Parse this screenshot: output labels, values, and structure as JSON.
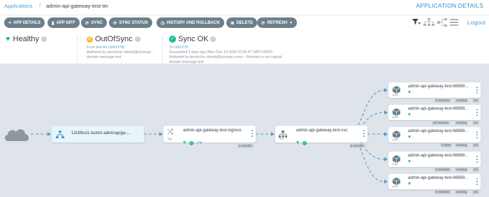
{
  "breadcrumb": {
    "applications": "Applications",
    "separator": "/",
    "app": "admin-api-gateway-test-tm"
  },
  "page_title": "APPLICATION DETAILS",
  "toolbar": {
    "app_details": "APP DETAILS",
    "app_diff": "APP DIFF",
    "sync": "SYNC",
    "sync_status": "SYNC STATUS",
    "history": "HISTORY AND ROLLBACK",
    "delete": "DELETE",
    "refresh": "REFRESH",
    "logout": "Logout"
  },
  "health": {
    "title": "Healthy"
  },
  "sync_state": {
    "title": "OutOfSync",
    "from_label": "From",
    "from_link": "test-tm",
    "from_rev": "(cb51278)",
    "authored": "Authored by derekcha <derek@soomgo...",
    "message": "domain message test"
  },
  "last_sync": {
    "title": "Sync OK",
    "to_label": "To",
    "to_rev": "cb51278",
    "succeeded": "Succeeded 3 days ago (Mon Dec 14 2020 22:36:47 GMT+0900)",
    "authored": "Authored by derekcha <derek@soomgo.com> - Revision is not signed.",
    "message": "domain message test"
  },
  "graph": {
    "app": {
      "name": "13c99cd1-testtm-adminapiga-..."
    },
    "ingress": {
      "name": "admin-api-gateway-test-ingress",
      "kind": "ing",
      "age": "2 months"
    },
    "svc": {
      "name": "admin-api-gateway-test-svc",
      "kind": "svc",
      "age": "6 months"
    },
    "pods": [
      {
        "name": "admin-api-gateway-test-66969...",
        "kind": "pod",
        "age": "6 minutes",
        "status": "running",
        "ready": "1/1"
      },
      {
        "name": "admin-api-gateway-test-66969...",
        "kind": "pod",
        "age": "13 minutes",
        "status": "running",
        "ready": "1/1"
      },
      {
        "name": "admin-api-gateway-test-66969...",
        "kind": "pod",
        "age": "3 days",
        "status": "running",
        "ready": "1/1"
      },
      {
        "name": "admin-api-gateway-test-66969...",
        "kind": "pod",
        "age": "5 minutes",
        "status": "running",
        "ready": "1/1"
      },
      {
        "name": "admin-api-gateway-test-66969...",
        "kind": "pod",
        "age": "6 minutes",
        "status": "running",
        "ready": "1/1"
      }
    ]
  },
  "colors": {
    "healthy": "#18be94",
    "out_of_sync": "#f4c030",
    "accent": "#4a9fd8",
    "button": "#6d7f8b",
    "edge": "#4a9fd8"
  },
  "icons": [
    "heart-icon",
    "circle-arrow-icon",
    "check-circle-icon",
    "filter-icon",
    "tree-icon",
    "list-icon",
    "cloud-icon",
    "shuffle-icon",
    "network-icon",
    "cube-icon",
    "kebab-menu-icon"
  ]
}
